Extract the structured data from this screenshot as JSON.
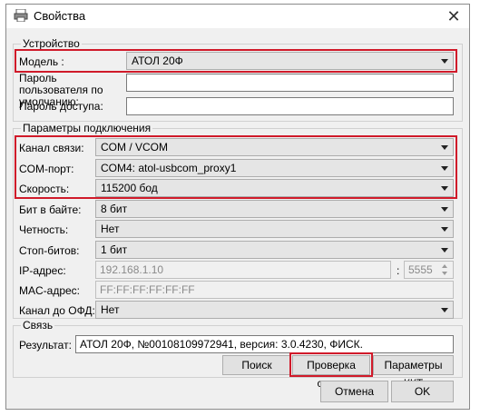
{
  "window": {
    "title": "Свойства",
    "close_symbol": "✕"
  },
  "device_group": {
    "title": "Устройство",
    "model_label": "Модель :",
    "model_value": "АТОЛ 20Ф",
    "user_password_label": "Пароль пользователя по умолчанию:",
    "user_password_value": "",
    "access_password_label": "Пароль доступа:",
    "access_password_value": ""
  },
  "connection_group": {
    "title": "Параметры подключения",
    "channel_label": "Канал связи:",
    "channel_value": "COM / VCOM",
    "port_label": "COM-порт:",
    "port_value": "COM4: atol-usbcom_proxy1",
    "speed_label": "Скорость:",
    "speed_value": "115200 бод",
    "bits_label": "Бит в байте:",
    "bits_value": "8 бит",
    "parity_label": "Четность:",
    "parity_value": "Нет",
    "stopbits_label": "Стоп-битов:",
    "stopbits_value": "1 бит",
    "ip_label": "IP-адрес:",
    "ip_value": "192.168.1.10",
    "ip_port_separator": ":",
    "ip_port_value": "5555",
    "mac_label": "MAC-адрес:",
    "mac_value": "FF:FF:FF:FF:FF:FF",
    "ofd_label": "Канал до ОФД:",
    "ofd_value": "Нет"
  },
  "link_group": {
    "title": "Связь",
    "result_label": "Результат:",
    "result_value": "АТОЛ 20Ф, №00108109972941, версия: 3.0.4230, ФИСК.",
    "search_button": "Поиск",
    "check_button": "Проверка связи",
    "kkt_params_button": "Параметры ККТ"
  },
  "footer": {
    "cancel_button": "Отмена",
    "ok_button": "OK"
  },
  "colors": {
    "highlight": "#d01a2a",
    "window_bg": "#f0f0f0",
    "combo_bg": "#e5e5e5"
  },
  "icons": {
    "title_icon": "printer-icon",
    "close_icon": "close-icon",
    "dropdown_icon": "chevron-down-icon"
  }
}
